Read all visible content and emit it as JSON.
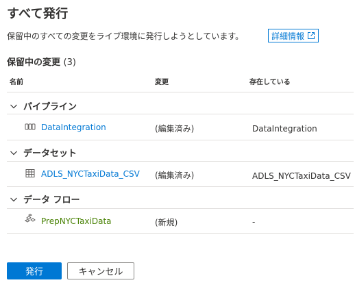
{
  "dialog": {
    "title": "すべて発行",
    "description": "保留中のすべての変更をライブ環境に発行しようとしています。",
    "learn_more": "詳細情報"
  },
  "pending": {
    "title": "保留中の変更",
    "count": "(3)"
  },
  "columns": {
    "name": "名前",
    "change": "変更",
    "existing": "存在している"
  },
  "groups": [
    {
      "label": "パイプライン",
      "icon": "pipeline-icon",
      "item": {
        "name": "DataIntegration",
        "change": "(編集済み)",
        "existing": "DataIntegration",
        "color": "#0078d4"
      }
    },
    {
      "label": "データセット",
      "icon": "dataset-table-icon",
      "item": {
        "name": "ADLS_NYCTaxiData_CSV",
        "change": "(編集済み)",
        "existing": "ADLS_NYCTaxiData_CSV",
        "color": "#0078d4"
      }
    },
    {
      "label": "データ フロー",
      "icon": "dataflow-icon",
      "item": {
        "name": "PrepNYCTaxiData",
        "change": "(新規)",
        "existing": "-",
        "color": "#498205"
      }
    }
  ],
  "buttons": {
    "publish": "発行",
    "cancel": "キャンセル"
  },
  "colors": {
    "accent": "#0078d4",
    "new_item": "#498205",
    "divider": "#e1dfdd"
  }
}
